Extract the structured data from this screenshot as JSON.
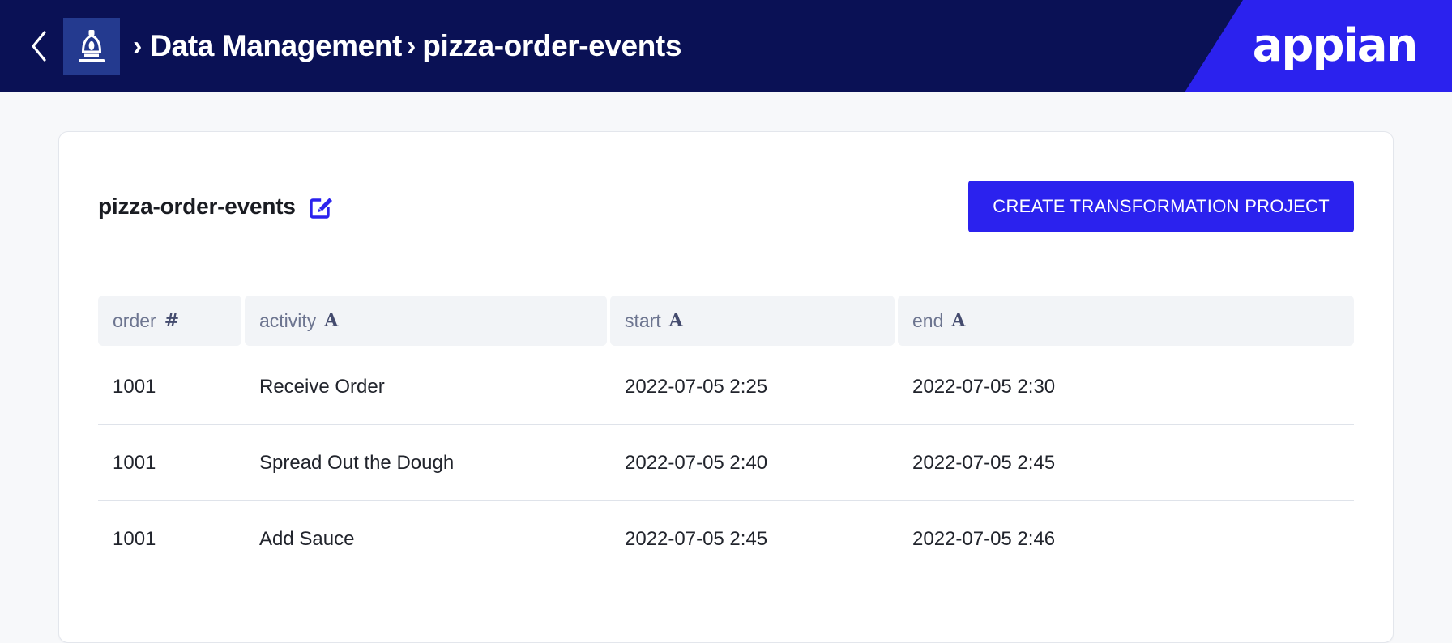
{
  "topnav": {
    "back_icon": "chevron-left-icon",
    "app_icon": "data-management-app-icon",
    "breadcrumb": {
      "separator": "›",
      "parent_label": "Data Management",
      "current_label": "pizza-order-events"
    },
    "apps_icon": "grid-apps-icon",
    "user_icon": "user-avatar-icon",
    "user_menu_icon": "chevron-down-icon",
    "brand": "appian",
    "colors": {
      "nav_background": "#0a1155",
      "brand_background": "#2b22ee",
      "app_badge": "#243a8f"
    }
  },
  "card": {
    "title": "pizza-order-events",
    "edit_icon": "edit-pencil-icon",
    "primary_button": "CREATE TRANSFORMATION PROJECT",
    "primary_button_color": "#2b22ee"
  },
  "table": {
    "columns": [
      {
        "label": "order",
        "type_badge": "#"
      },
      {
        "label": "activity",
        "type_badge": "A"
      },
      {
        "label": "start",
        "type_badge": "A"
      },
      {
        "label": "end",
        "type_badge": "A"
      }
    ],
    "rows": [
      {
        "order": "1001",
        "activity": "Receive Order",
        "start": "2022-07-05 2:25",
        "end": "2022-07-05 2:30"
      },
      {
        "order": "1001",
        "activity": "Spread Out the Dough",
        "start": "2022-07-05 2:40",
        "end": "2022-07-05 2:45"
      },
      {
        "order": "1001",
        "activity": "Add Sauce",
        "start": "2022-07-05 2:45",
        "end": "2022-07-05 2:46"
      }
    ]
  }
}
